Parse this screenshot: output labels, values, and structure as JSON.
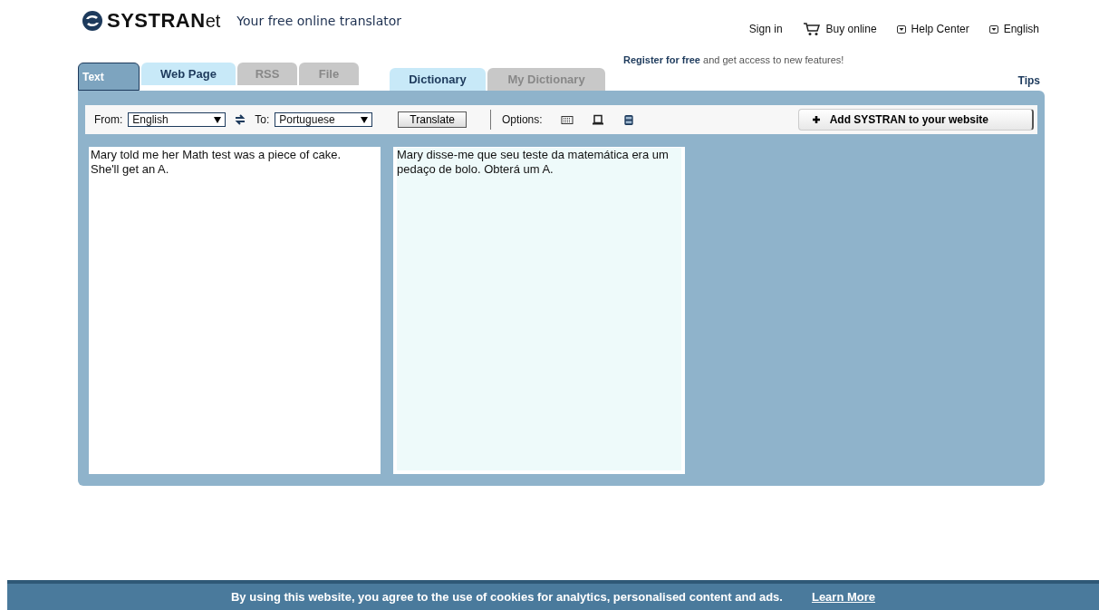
{
  "header": {
    "logo": "SYSTRAN",
    "logo_suffix": "et",
    "tagline": "Your free online translator"
  },
  "top_links": [
    {
      "label": "Sign in",
      "kind": "plain"
    },
    {
      "label": "Buy online",
      "kind": "cart"
    },
    {
      "label": "Help Center",
      "kind": "menu"
    },
    {
      "label": "English",
      "kind": "menu"
    }
  ],
  "tabs": [
    {
      "label": "Text",
      "selected": true,
      "disabled": false
    },
    {
      "label": "Web Page",
      "selected": false,
      "disabled": false
    },
    {
      "label": "RSS",
      "selected": false,
      "disabled": true
    },
    {
      "label": "File",
      "selected": false,
      "disabled": true
    }
  ],
  "dict_tabs": [
    {
      "label": "Dictionary",
      "selected": false,
      "disabled": false
    },
    {
      "label": "My Dictionary",
      "selected": false,
      "disabled": true
    }
  ],
  "register_note": "**Register for free** and get access to new features!",
  "tips": "Tips",
  "toolbar": {
    "from_label": "From:",
    "from_value": "English",
    "to_label": "To:",
    "to_value": "Portuguese",
    "translate": "Translate",
    "options_label": "Options:",
    "add_button": "Add SYSTRAN to your website"
  },
  "source_text": "Mary told me her Math test was a piece of cake. She'll get an A.",
  "result_text": "Mary disse-me que seu teste da matemática era um pedaço de bolo. Obterá um A.",
  "cookie_bar": {
    "message": "By using this website, you agree to the use of cookies for analytics, personalised content and ads.",
    "link": "Learn More"
  }
}
